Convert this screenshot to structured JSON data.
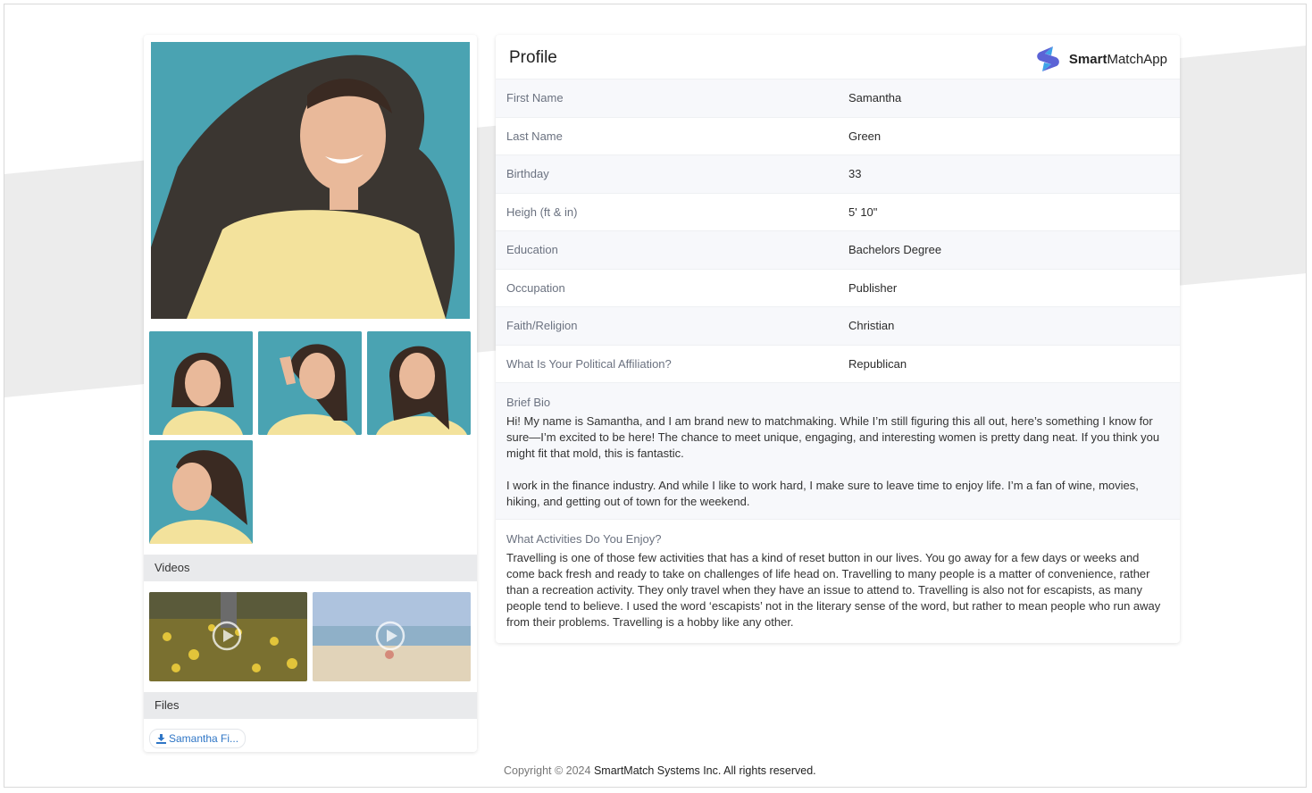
{
  "colors": {
    "accent_link": "#2f76c6",
    "photo_bg": "#4aa3b2",
    "shirt": "#f3e29c",
    "section_bar": "#e9eaec"
  },
  "gallery": {
    "main_photo": "woman-portrait-photo",
    "thumbnails": [
      "portrait-thumb-1",
      "portrait-thumb-2",
      "portrait-thumb-3",
      "portrait-thumb-4"
    ]
  },
  "videos": {
    "title": "Videos",
    "items": [
      "video-field-thumbnail",
      "video-beach-thumbnail"
    ]
  },
  "files": {
    "title": "Files",
    "items": [
      {
        "label": "Samantha Fi...",
        "icon": "download-icon"
      }
    ]
  },
  "profile": {
    "title": "Profile",
    "brand": {
      "bold": "Smart",
      "rest": "MatchApp",
      "icon": "smartmatch-logo-icon"
    },
    "fields": [
      {
        "label": "First Name",
        "value": "Samantha"
      },
      {
        "label": "Last Name",
        "value": "Green"
      },
      {
        "label": "Birthday",
        "value": "33"
      },
      {
        "label": "Heigh (ft & in)",
        "value": "5' 10\""
      },
      {
        "label": "Education",
        "value": "Bachelors Degree"
      },
      {
        "label": "Occupation",
        "value": "Publisher"
      },
      {
        "label": "Faith/Religion",
        "value": "Christian"
      },
      {
        "label": "What Is Your Political Affiliation?",
        "value": "Republican"
      }
    ],
    "bio": {
      "label": "Brief Bio",
      "paragraphs": [
        "Hi! My name is Samantha, and I am brand new to matchmaking. While I’m still figuring this all out, here’s something I know for sure—I’m excited to be here! The chance to meet unique, engaging, and interesting women is pretty dang neat. If you think you might fit that mold, this is fantastic.",
        "I work in the finance industry. And while I like to work hard, I make sure to leave time to enjoy life. I’m a fan of wine, movies, hiking, and getting out of town for the weekend."
      ]
    },
    "activities": {
      "label": "What Activities Do You Enjoy?",
      "text": "Travelling is one of those few activities that has a kind of reset button in our lives. You go away for a few days or weeks and come back fresh and ready to take on challenges of life head on. Travelling to many people is a matter of convenience, rather than a recreation activity. They only travel when they have an issue to attend to. Travelling is also not for escapists, as many people tend to believe. I used the word ‘escapists’ not in the literary sense of the word, but rather to mean people who run away from their problems. Travelling is a hobby like any other."
    }
  },
  "footer": {
    "prefix": "Copyright © 2024",
    "company": "SmartMatch Systems Inc. All rights reserved."
  }
}
